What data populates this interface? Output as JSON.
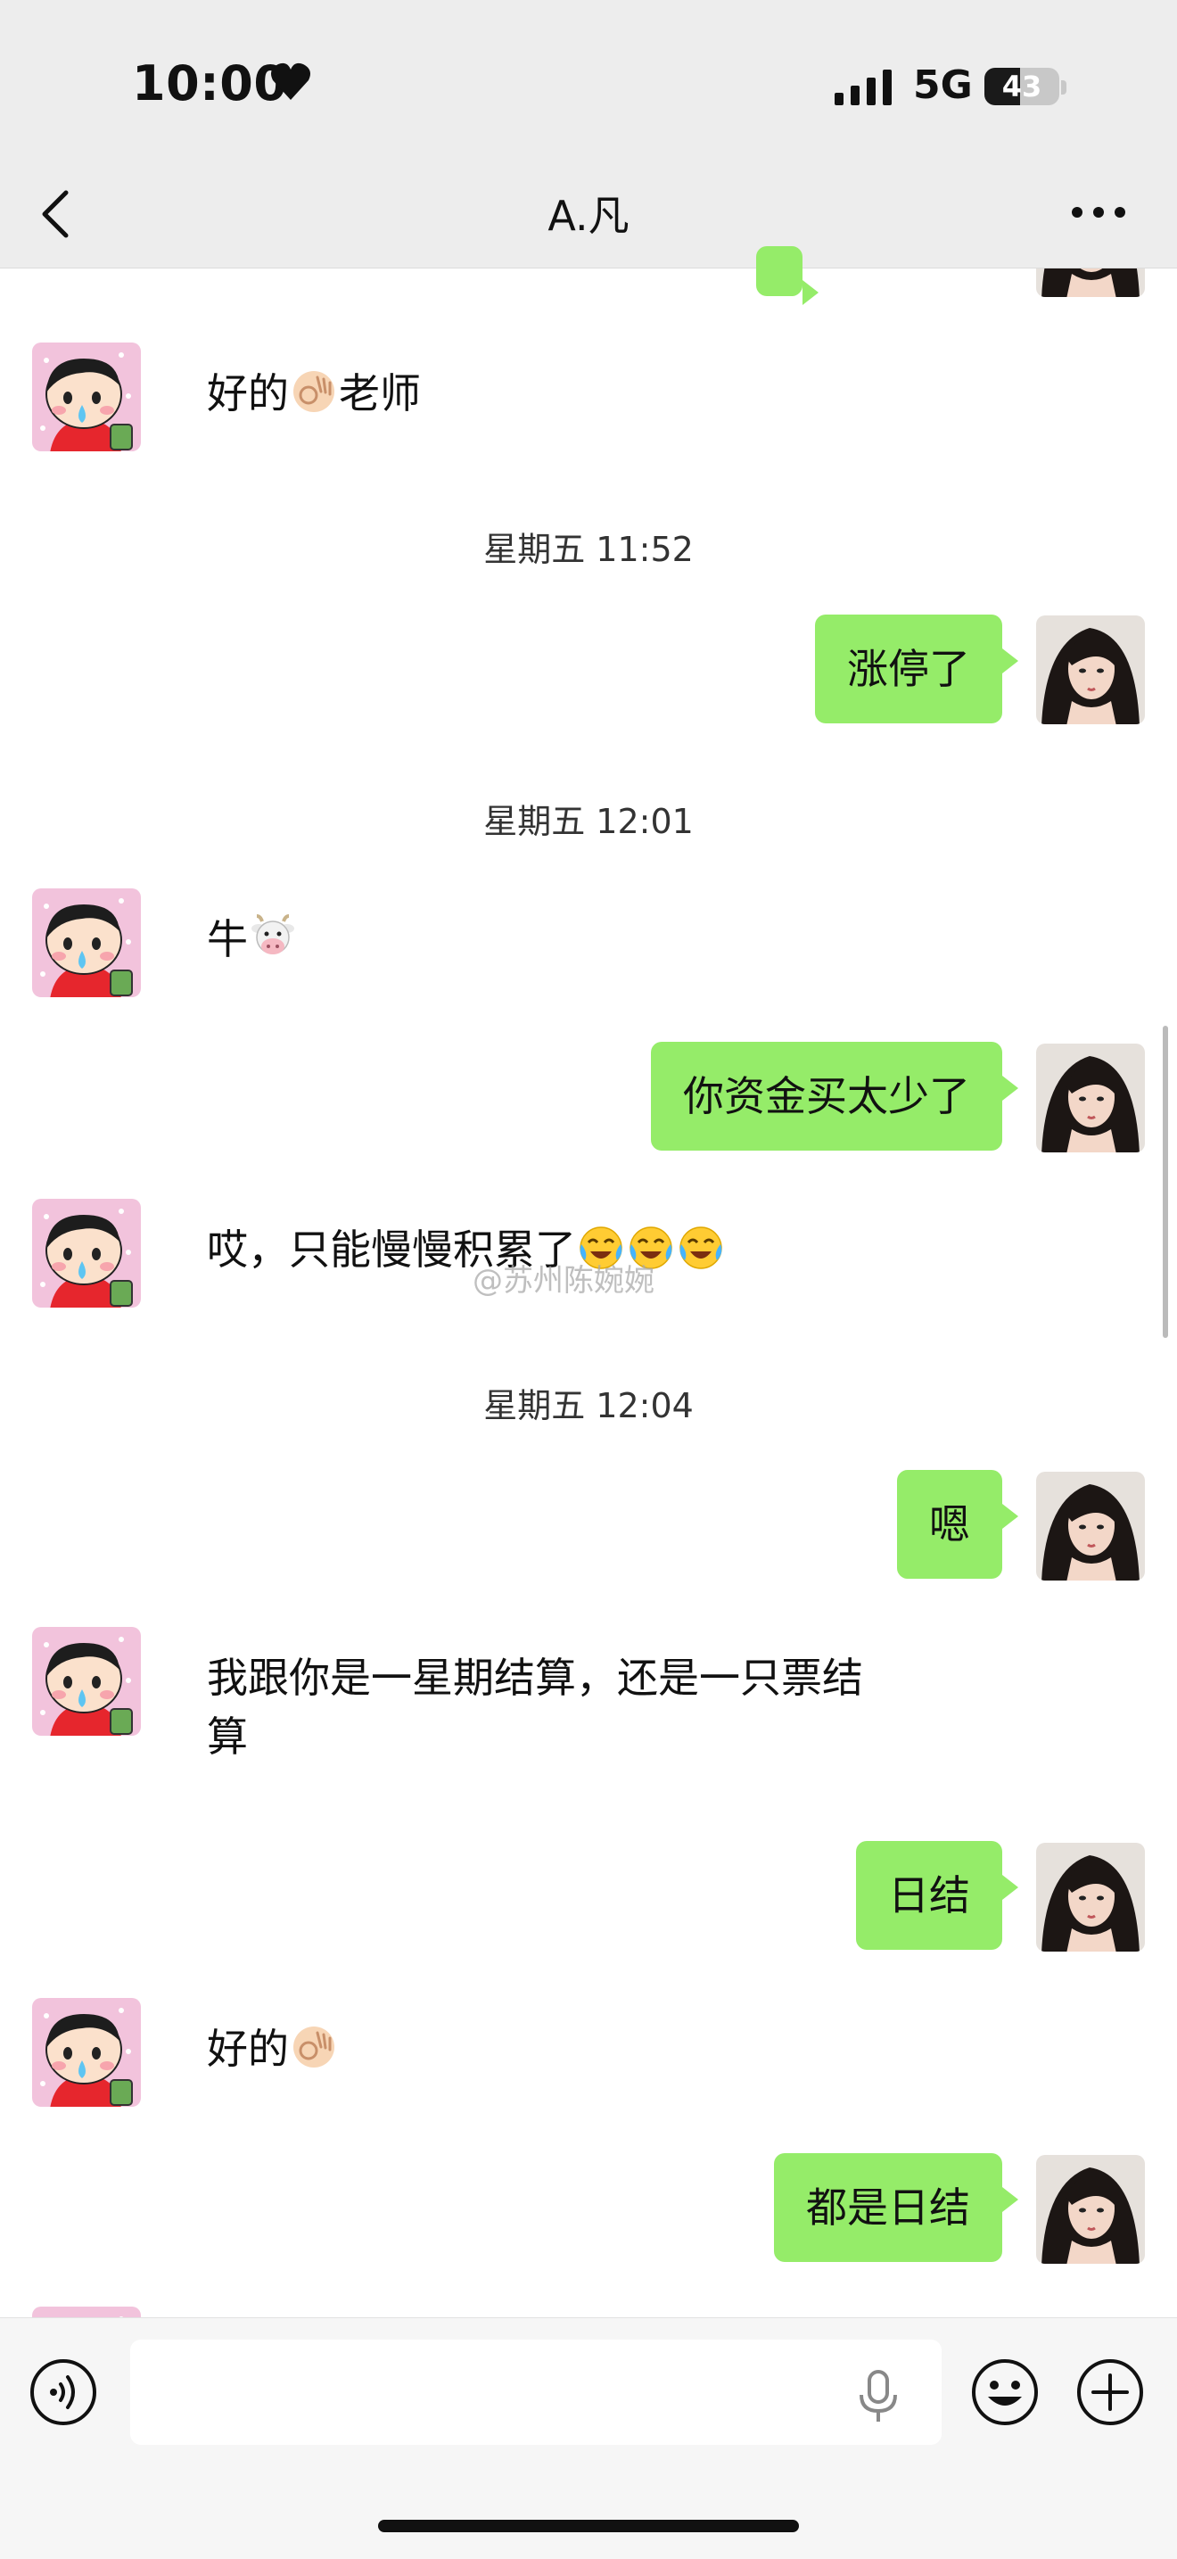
{
  "status": {
    "time": "10:00",
    "network": "5G",
    "battery": "43"
  },
  "header": {
    "title": "A.凡"
  },
  "messages": [
    {
      "side": "left",
      "text": "好的",
      "suffix": "老师"
    },
    {
      "type": "time",
      "text": "星期五 11:52"
    },
    {
      "side": "right",
      "text": "涨停了"
    },
    {
      "type": "time",
      "text": "星期五 12:01"
    },
    {
      "side": "left",
      "text": "牛"
    },
    {
      "side": "right",
      "text": "你资金买太少了"
    },
    {
      "side": "left",
      "text": "哎，只能慢慢积累了"
    },
    {
      "type": "time",
      "text": "星期五 12:04"
    },
    {
      "side": "right",
      "text": "嗯"
    },
    {
      "side": "left",
      "text": "我跟你是一星期结算，还是一只票结",
      "line2": "算"
    },
    {
      "side": "right",
      "text": "日结"
    },
    {
      "side": "left",
      "text": "好的"
    },
    {
      "side": "right",
      "text": "都是日结"
    }
  ],
  "watermark": "@苏州陈婉婉",
  "icons": {
    "back": "chevron-left-icon",
    "more": "more-dots-icon",
    "voice": "voice-icon",
    "emoji": "emoji-icon",
    "plus": "plus-icon",
    "mic": "microphone-icon"
  },
  "colors": {
    "bubble_right": "#95ec69",
    "bubble_left": "#ffffff",
    "background": "#ededed"
  }
}
